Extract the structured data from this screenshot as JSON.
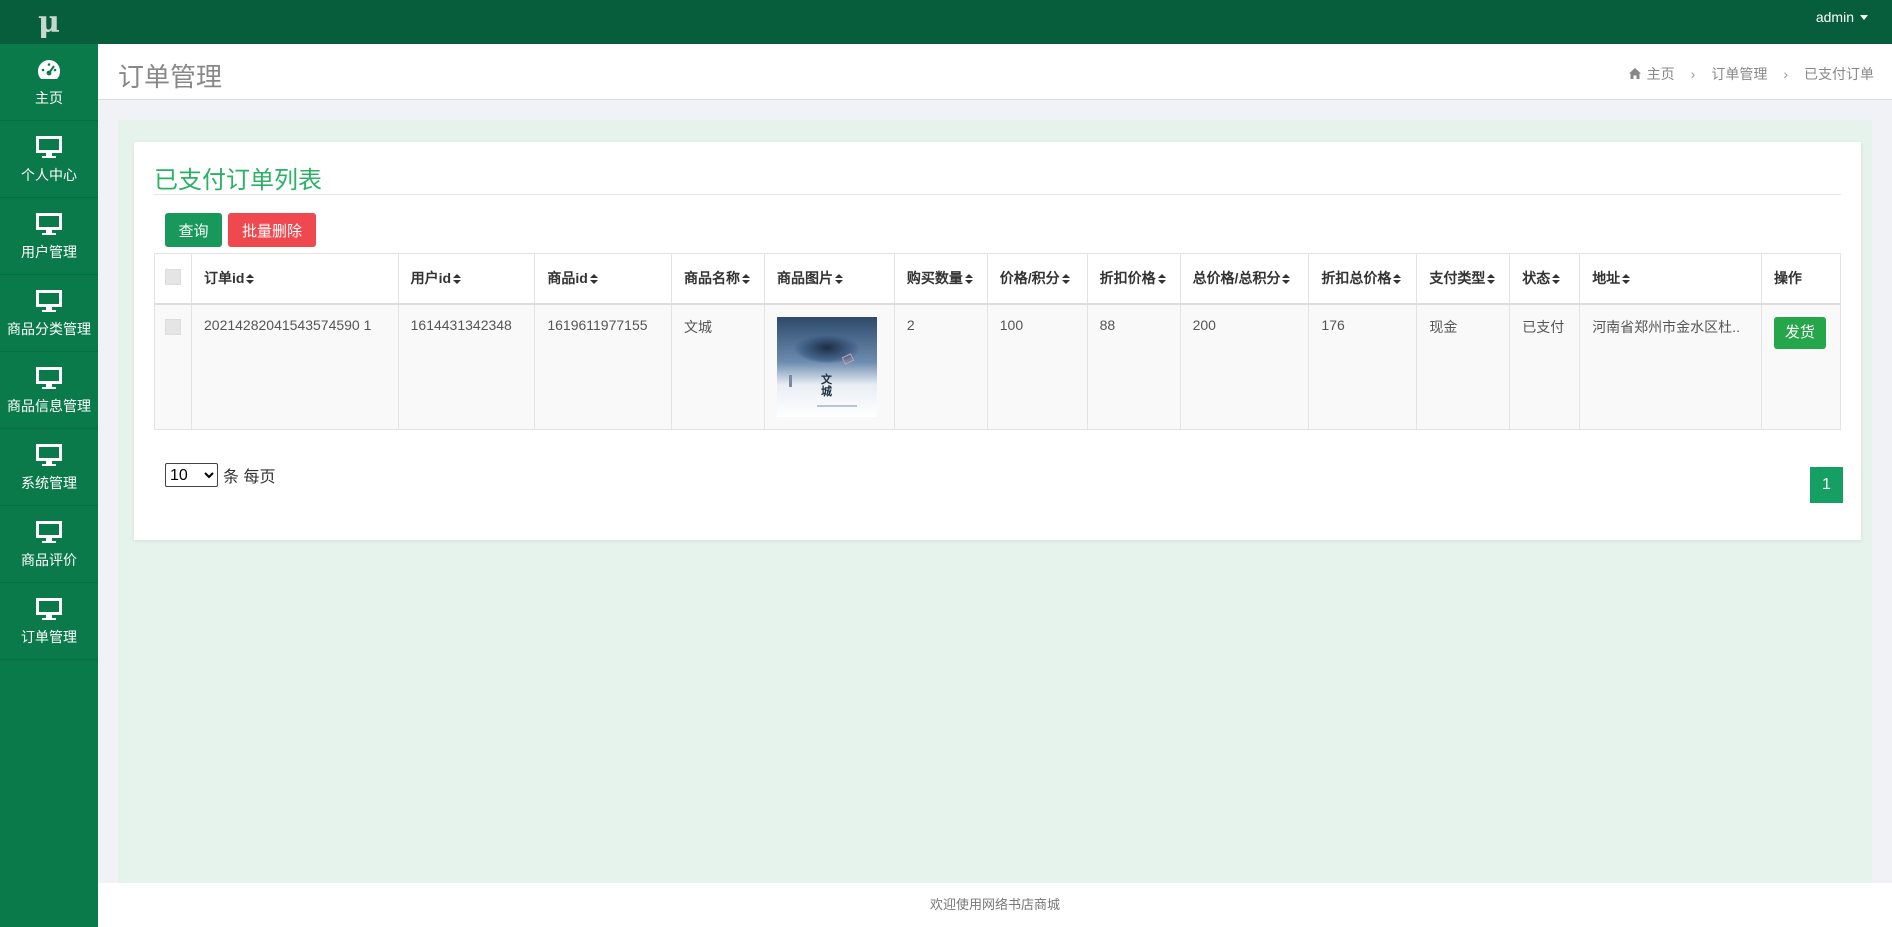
{
  "app": {
    "logo": "μ",
    "user": "admin"
  },
  "sidebar": {
    "items": [
      {
        "label": "主页",
        "icon": "dashboard-icon"
      },
      {
        "label": "个人中心",
        "icon": "monitor-icon"
      },
      {
        "label": "用户管理",
        "icon": "monitor-icon"
      },
      {
        "label": "商品分类管理",
        "icon": "monitor-icon"
      },
      {
        "label": "商品信息管理",
        "icon": "monitor-icon"
      },
      {
        "label": "系统管理",
        "icon": "monitor-icon"
      },
      {
        "label": "商品评价",
        "icon": "monitor-icon"
      },
      {
        "label": "订单管理",
        "icon": "monitor-icon"
      }
    ]
  },
  "header": {
    "title": "订单管理",
    "breadcrumb": [
      "主页",
      "订单管理",
      "已支付订单"
    ]
  },
  "card": {
    "title": "已支付订单列表",
    "query_label": "查询",
    "delete_label": "批量删除"
  },
  "table": {
    "columns": [
      "订单id",
      "用户id",
      "商品id",
      "商品名称",
      "商品图片",
      "购买数量",
      "价格/积分",
      "折扣价格",
      "总价格/总积分",
      "折扣总价格",
      "支付类型",
      "状态",
      "地址",
      "操作"
    ],
    "rows": [
      {
        "order_id": "20214282041543574590 1",
        "user_id": "1614431342348",
        "product_id": "1619611977155",
        "product_name": "文城",
        "image_text_1": "文",
        "image_text_2": "城",
        "quantity": "2",
        "price": "100",
        "discount_price": "88",
        "total_price": "200",
        "discount_total": "176",
        "pay_type": "现金",
        "status": "已支付",
        "address": "河南省郑州市金水区杜..",
        "action_label": "发货"
      }
    ]
  },
  "pagination": {
    "page_size": "10",
    "page_size_options": [
      "10"
    ],
    "page_size_suffix": "条 每页",
    "current_page": "1"
  },
  "footer": {
    "text": "欢迎使用网络书店商城"
  },
  "colors": {
    "sidebar": "#0b7a4b",
    "topbar": "#065e3c",
    "accent": "#2bb166",
    "danger": "#f0484f",
    "success": "#26a64a"
  }
}
